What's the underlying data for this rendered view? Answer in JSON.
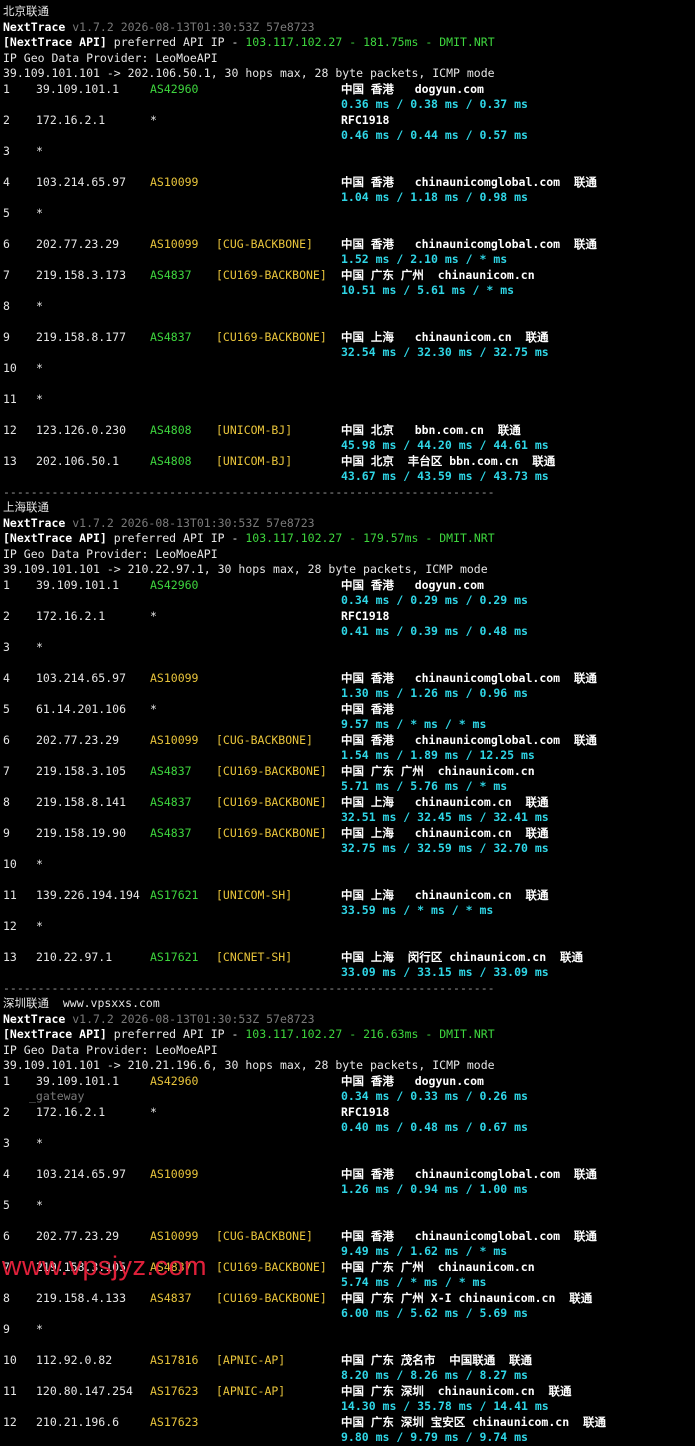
{
  "colors": {
    "background": "#000000",
    "text": "#e6e6e6",
    "asn": "#3ed63e",
    "tag": "#e8c43b",
    "latency": "#2fd6e6",
    "meta": "#7a7a7a",
    "watermark": "#e0203a"
  },
  "sections": [
    {
      "title": "北京联通",
      "tool": "NextTrace",
      "version": " v1.7.2 2026-08-13T01:30:53Z 57e8723",
      "api_prefix": "[NextTrace API]",
      "api_mid": " preferred API IP - ",
      "api_ip": "103.117.102.27",
      "api_ms": "181.75ms",
      "api_node": "DMIT.NRT",
      "dash": " - ",
      "geo_provider": "IP Geo Data Provider: LeoMoeAPI",
      "route": "39.109.101.101 -> 202.106.50.1, 30 hops max, 28 byte packets, ICMP mode",
      "hops": [
        {
          "n": "1",
          "ip": "39.109.101.1",
          "as": "AS42960",
          "as_color": "green",
          "tag": "",
          "geo": "中国 香港   dogyun.com",
          "lat": "0.36 ms / 0.38 ms / 0.37 ms"
        },
        {
          "n": "2",
          "ip": "172.16.2.1",
          "as": "*",
          "as_color": "plain",
          "tag": "",
          "geo": "RFC1918",
          "lat": "0.46 ms / 0.44 ms / 0.57 ms"
        },
        {
          "n": "3",
          "ip": "*",
          "as": "",
          "as_color": "plain",
          "tag": "",
          "geo": "",
          "lat": ""
        },
        {
          "n": "4",
          "ip": "103.214.65.97",
          "as": "AS10099",
          "as_color": "yellow",
          "tag": "",
          "geo": "中国 香港   chinaunicomglobal.com  联通",
          "lat": "1.04 ms / 1.18 ms / 0.98 ms"
        },
        {
          "n": "5",
          "ip": "*",
          "as": "",
          "as_color": "plain",
          "tag": "",
          "geo": "",
          "lat": ""
        },
        {
          "n": "6",
          "ip": "202.77.23.29",
          "as": "AS10099",
          "as_color": "yellow",
          "tag": "[CUG-BACKBONE]",
          "geo": "中国 香港   chinaunicomglobal.com  联通",
          "lat": "1.52 ms / 2.10 ms / * ms"
        },
        {
          "n": "7",
          "ip": "219.158.3.173",
          "as": "AS4837",
          "as_color": "green",
          "tag": "[CU169-BACKBONE]",
          "geo": "中国 广东 广州  chinaunicom.cn",
          "lat": "10.51 ms / 5.61 ms / * ms"
        },
        {
          "n": "8",
          "ip": "*",
          "as": "",
          "as_color": "plain",
          "tag": "",
          "geo": "",
          "lat": ""
        },
        {
          "n": "9",
          "ip": "219.158.8.177",
          "as": "AS4837",
          "as_color": "green",
          "tag": "[CU169-BACKBONE]",
          "geo": "中国 上海   chinaunicom.cn  联通",
          "lat": "32.54 ms / 32.30 ms / 32.75 ms"
        },
        {
          "n": "10",
          "ip": "*",
          "as": "",
          "as_color": "plain",
          "tag": "",
          "geo": "",
          "lat": ""
        },
        {
          "n": "11",
          "ip": "*",
          "as": "",
          "as_color": "plain",
          "tag": "",
          "geo": "",
          "lat": ""
        },
        {
          "n": "12",
          "ip": "123.126.0.230",
          "as": "AS4808",
          "as_color": "green",
          "tag": "[UNICOM-BJ]",
          "geo": "中国 北京   bbn.com.cn  联通",
          "lat": "45.98 ms / 44.20 ms / 44.61 ms"
        },
        {
          "n": "13",
          "ip": "202.106.50.1",
          "as": "AS4808",
          "as_color": "green",
          "tag": "[UNICOM-BJ]",
          "geo": "中国 北京  丰台区 bbn.com.cn  联通",
          "lat": "43.67 ms / 43.59 ms / 43.73 ms"
        }
      ]
    },
    {
      "title": "上海联通",
      "tool": "NextTrace",
      "version": " v1.7.2 2026-08-13T01:30:53Z 57e8723",
      "api_prefix": "[NextTrace API]",
      "api_mid": " preferred API IP - ",
      "api_ip": "103.117.102.27",
      "api_ms": "179.57ms",
      "api_node": "DMIT.NRT",
      "dash": " - ",
      "geo_provider": "IP Geo Data Provider: LeoMoeAPI",
      "route": "39.109.101.101 -> 210.22.97.1, 30 hops max, 28 byte packets, ICMP mode",
      "hops": [
        {
          "n": "1",
          "ip": "39.109.101.1",
          "as": "AS42960",
          "as_color": "green",
          "tag": "",
          "geo": "中国 香港   dogyun.com",
          "lat": "0.34 ms / 0.29 ms / 0.29 ms"
        },
        {
          "n": "2",
          "ip": "172.16.2.1",
          "as": "*",
          "as_color": "plain",
          "tag": "",
          "geo": "RFC1918",
          "lat": "0.41 ms / 0.39 ms / 0.48 ms"
        },
        {
          "n": "3",
          "ip": "*",
          "as": "",
          "as_color": "plain",
          "tag": "",
          "geo": "",
          "lat": ""
        },
        {
          "n": "4",
          "ip": "103.214.65.97",
          "as": "AS10099",
          "as_color": "yellow",
          "tag": "",
          "geo": "中国 香港   chinaunicomglobal.com  联通",
          "lat": "1.30 ms / 1.26 ms / 0.96 ms"
        },
        {
          "n": "5",
          "ip": "61.14.201.106",
          "as": "*",
          "as_color": "plain",
          "tag": "",
          "geo": "中国 香港",
          "lat": "9.57 ms / * ms / * ms"
        },
        {
          "n": "6",
          "ip": "202.77.23.29",
          "as": "AS10099",
          "as_color": "yellow",
          "tag": "[CUG-BACKBONE]",
          "geo": "中国 香港   chinaunicomglobal.com  联通",
          "lat": "1.54 ms / 1.89 ms / 12.25 ms"
        },
        {
          "n": "7",
          "ip": "219.158.3.105",
          "as": "AS4837",
          "as_color": "green",
          "tag": "[CU169-BACKBONE]",
          "geo": "中国 广东 广州  chinaunicom.cn",
          "lat": "5.71 ms / 5.76 ms / * ms"
        },
        {
          "n": "8",
          "ip": "219.158.8.141",
          "as": "AS4837",
          "as_color": "green",
          "tag": "[CU169-BACKBONE]",
          "geo": "中国 上海   chinaunicom.cn  联通",
          "lat": "32.51 ms / 32.45 ms / 32.41 ms"
        },
        {
          "n": "9",
          "ip": "219.158.19.90",
          "as": "AS4837",
          "as_color": "green",
          "tag": "[CU169-BACKBONE]",
          "geo": "中国 上海   chinaunicom.cn  联通",
          "lat": "32.75 ms / 32.59 ms / 32.70 ms"
        },
        {
          "n": "10",
          "ip": "*",
          "as": "",
          "as_color": "plain",
          "tag": "",
          "geo": "",
          "lat": ""
        },
        {
          "n": "11",
          "ip": "139.226.194.194",
          "as": "AS17621",
          "as_color": "green",
          "tag": "[UNICOM-SH]",
          "geo": "中国 上海   chinaunicom.cn  联通",
          "lat": "33.59 ms / * ms / * ms"
        },
        {
          "n": "12",
          "ip": "*",
          "as": "",
          "as_color": "plain",
          "tag": "",
          "geo": "",
          "lat": ""
        },
        {
          "n": "13",
          "ip": "210.22.97.1",
          "as": "AS17621",
          "as_color": "green",
          "tag": "[CNCNET-SH]",
          "geo": "中国 上海  闵行区 chinaunicom.cn  联通",
          "lat": "33.09 ms / 33.15 ms / 33.09 ms"
        }
      ]
    },
    {
      "title": "深圳联通  www.vpsxxs.com",
      "tool": "NextTrace",
      "version": " v1.7.2 2026-08-13T01:30:53Z 57e8723",
      "api_prefix": "[NextTrace API]",
      "api_mid": " preferred API IP - ",
      "api_ip": "103.117.102.27",
      "api_ms": "216.63ms",
      "api_node": "DMIT.NRT",
      "dash": " - ",
      "geo_provider": "IP Geo Data Provider: LeoMoeAPI",
      "route": "39.109.101.101 -> 210.21.196.6, 30 hops max, 28 byte packets, ICMP mode",
      "hops": [
        {
          "n": "1",
          "ip": "39.109.101.1",
          "as": "AS42960",
          "as_color": "yellow",
          "tag": "",
          "geo": "中国 香港   dogyun.com",
          "lat": "0.34 ms / 0.33 ms / 0.26 ms",
          "gateway": "_gateway"
        },
        {
          "n": "2",
          "ip": "172.16.2.1",
          "as": "*",
          "as_color": "plain",
          "tag": "",
          "geo": "RFC1918",
          "lat": "0.40 ms / 0.48 ms / 0.67 ms"
        },
        {
          "n": "3",
          "ip": "*",
          "as": "",
          "as_color": "plain",
          "tag": "",
          "geo": "",
          "lat": ""
        },
        {
          "n": "4",
          "ip": "103.214.65.97",
          "as": "AS10099",
          "as_color": "yellow",
          "tag": "",
          "geo": "中国 香港   chinaunicomglobal.com  联通",
          "lat": "1.26 ms / 0.94 ms / 1.00 ms"
        },
        {
          "n": "5",
          "ip": "*",
          "as": "",
          "as_color": "plain",
          "tag": "",
          "geo": "",
          "lat": ""
        },
        {
          "n": "6",
          "ip": "202.77.23.29",
          "as": "AS10099",
          "as_color": "yellow",
          "tag": "[CUG-BACKBONE]",
          "geo": "中国 香港   chinaunicomglobal.com  联通",
          "lat": "9.49 ms / 1.62 ms / * ms"
        },
        {
          "n": "7",
          "ip": "219.158.3.105",
          "as": "AS4837",
          "as_color": "yellow",
          "tag": "[CU169-BACKBONE]",
          "geo": "中国 广东 广州  chinaunicom.cn",
          "lat": "5.74 ms / * ms / * ms"
        },
        {
          "n": "8",
          "ip": "219.158.4.133",
          "as": "AS4837",
          "as_color": "yellow",
          "tag": "[CU169-BACKBONE]",
          "geo": "中国 广东 广州 X-I chinaunicom.cn  联通",
          "lat": "6.00 ms / 5.62 ms / 5.69 ms"
        },
        {
          "n": "9",
          "ip": "*",
          "as": "",
          "as_color": "plain",
          "tag": "",
          "geo": "",
          "lat": ""
        },
        {
          "n": "10",
          "ip": "112.92.0.82",
          "as": "AS17816",
          "as_color": "yellow",
          "tag": "[APNIC-AP]",
          "geo": "中国 广东 茂名市  中国联通  联通",
          "lat": "8.20 ms / 8.26 ms / 8.27 ms"
        },
        {
          "n": "11",
          "ip": "120.80.147.254",
          "as": "AS17623",
          "as_color": "yellow",
          "tag": "[APNIC-AP]",
          "geo": "中国 广东 深圳  chinaunicom.cn  联通",
          "lat": "14.30 ms / 35.78 ms / 14.41 ms"
        },
        {
          "n": "12",
          "ip": "210.21.196.6",
          "as": "AS17623",
          "as_color": "yellow",
          "tag": "",
          "geo": "中国 广东 深圳 宝安区 chinaunicom.cn  联通",
          "lat": "9.80 ms / 9.79 ms / 9.74 ms"
        }
      ]
    }
  ],
  "separator": "-----------------------------------------------------------------------",
  "watermark": "www.vpsjyz.com"
}
